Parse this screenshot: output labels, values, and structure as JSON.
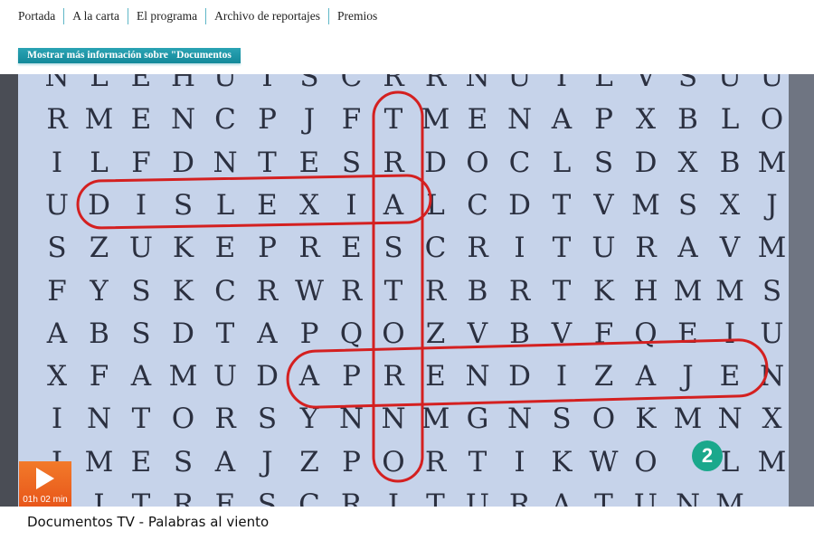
{
  "nav": {
    "items": [
      "Portada",
      "A la carta",
      "El programa",
      "Archivo de reportajes",
      "Premios"
    ]
  },
  "more_info_button": "Mostrar más información sobre \"Documentos TV\"",
  "video": {
    "grid_rows": [
      "NLEHUISCRRNUILVSUU",
      "RMENCPJFTMENAPXBLO",
      "ILFDNTESRDOCLSDXBM",
      "UDISLEXIALCDTVMSXJ",
      "SZUKEPRESCRITURAVM",
      "FYSKCRWRTRBRTKHMMS",
      "ABSDTAPQOZVBVFQEIU",
      "XFAMUDAPRENDIZAJEN",
      "INTORSYNNMGNSOKMNX",
      "IMESAJZPORTIKWO LM",
      "UITRESCRITURATUNM "
    ],
    "channel_logo": "2",
    "duration": "01h 02 min",
    "circle_color": "#d42020"
  },
  "video_title": "Documentos TV - Palabras al viento"
}
